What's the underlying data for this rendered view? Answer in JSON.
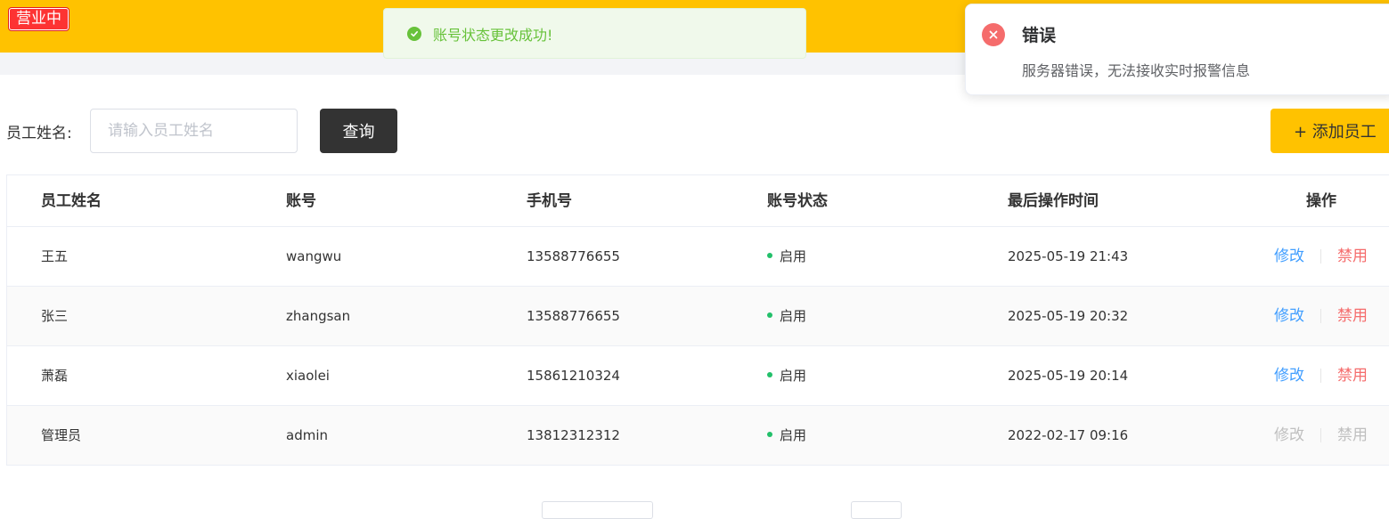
{
  "header": {
    "status_badge": "营业中",
    "accent_color": "#ffc200"
  },
  "toast": {
    "icon": "check-circle-icon",
    "message": "账号状态更改成功!",
    "color": "#67c23a"
  },
  "notification": {
    "icon": "close-circle-icon",
    "title": "错误",
    "message": "服务器错误，无法接收实时报警信息",
    "color": "#f56c6c"
  },
  "search": {
    "label": "员工姓名:",
    "placeholder": "请输入员工姓名",
    "value": "",
    "query_label": "查询",
    "add_label": "+ 添加员工"
  },
  "table": {
    "columns": [
      "员工姓名",
      "账号",
      "手机号",
      "账号状态",
      "最后操作时间",
      "操作"
    ],
    "rows": [
      {
        "name": "王五",
        "account": "wangwu",
        "phone": "13588776655",
        "status": "启用",
        "time": "2025-05-19 21:43",
        "edit": "修改",
        "ban": "禁用",
        "disabled": false
      },
      {
        "name": "张三",
        "account": "zhangsan",
        "phone": "13588776655",
        "status": "启用",
        "time": "2025-05-19 20:32",
        "edit": "修改",
        "ban": "禁用",
        "disabled": false
      },
      {
        "name": "萧磊",
        "account": "xiaolei",
        "phone": "15861210324",
        "status": "启用",
        "time": "2025-05-19 20:14",
        "edit": "修改",
        "ban": "禁用",
        "disabled": false
      },
      {
        "name": "管理员",
        "account": "admin",
        "phone": "13812312312",
        "status": "启用",
        "time": "2022-02-17 09:16",
        "edit": "修改",
        "ban": "禁用",
        "disabled": true
      }
    ],
    "status_color": "#22c06a",
    "edit_color": "#419eff",
    "ban_color": "#f56c6c"
  }
}
